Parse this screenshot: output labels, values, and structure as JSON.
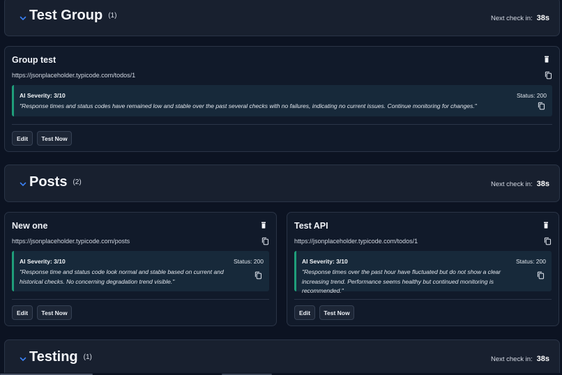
{
  "next_check_label": "Next check in:",
  "groups": [
    {
      "title": "Test Group",
      "count": "(1)",
      "next_check": "38s",
      "monitors": [
        {
          "name": "Group test",
          "url": "https://jsonplaceholder.typicode.com/todos/1",
          "severity": "AI Severity: 3/10",
          "status": "Status: 200",
          "analysis": "\"Response times and status codes have remained low and stable over the past several checks with no failures, indicating no current issues. Continue monitoring for changes.\"",
          "edit_label": "Edit",
          "test_label": "Test Now"
        }
      ]
    },
    {
      "title": "Posts",
      "count": "(2)",
      "next_check": "38s",
      "monitors": [
        {
          "name": "New one",
          "url": "https://jsonplaceholder.typicode.com/posts",
          "severity": "AI Severity: 3/10",
          "status": "Status: 200",
          "analysis": "\"Response time and status code look normal and stable based on current and historical checks. No concerning degradation trend visible.\"",
          "edit_label": "Edit",
          "test_label": "Test Now"
        },
        {
          "name": "Test API",
          "url": "https://jsonplaceholder.typicode.com/todos/1",
          "severity": "AI Severity: 3/10",
          "status": "Status: 200",
          "analysis": "\"Response times over the past hour have fluctuated but do not show a clear increasing trend. Performance seems healthy but continued monitoring is recommended.\"",
          "edit_label": "Edit",
          "test_label": "Test Now"
        }
      ]
    },
    {
      "title": "Testing",
      "count": "(1)",
      "next_check": "38s"
    }
  ],
  "icons": {
    "collapse": "chevron-down-icon",
    "delete": "trash-icon",
    "copy": "copy-icon"
  },
  "colors": {
    "background": "#0c1322",
    "card": "#111a2a",
    "ai_box": "#17293a",
    "ai_accent": "#1f9e7a",
    "chevron": "#3b82f6"
  }
}
